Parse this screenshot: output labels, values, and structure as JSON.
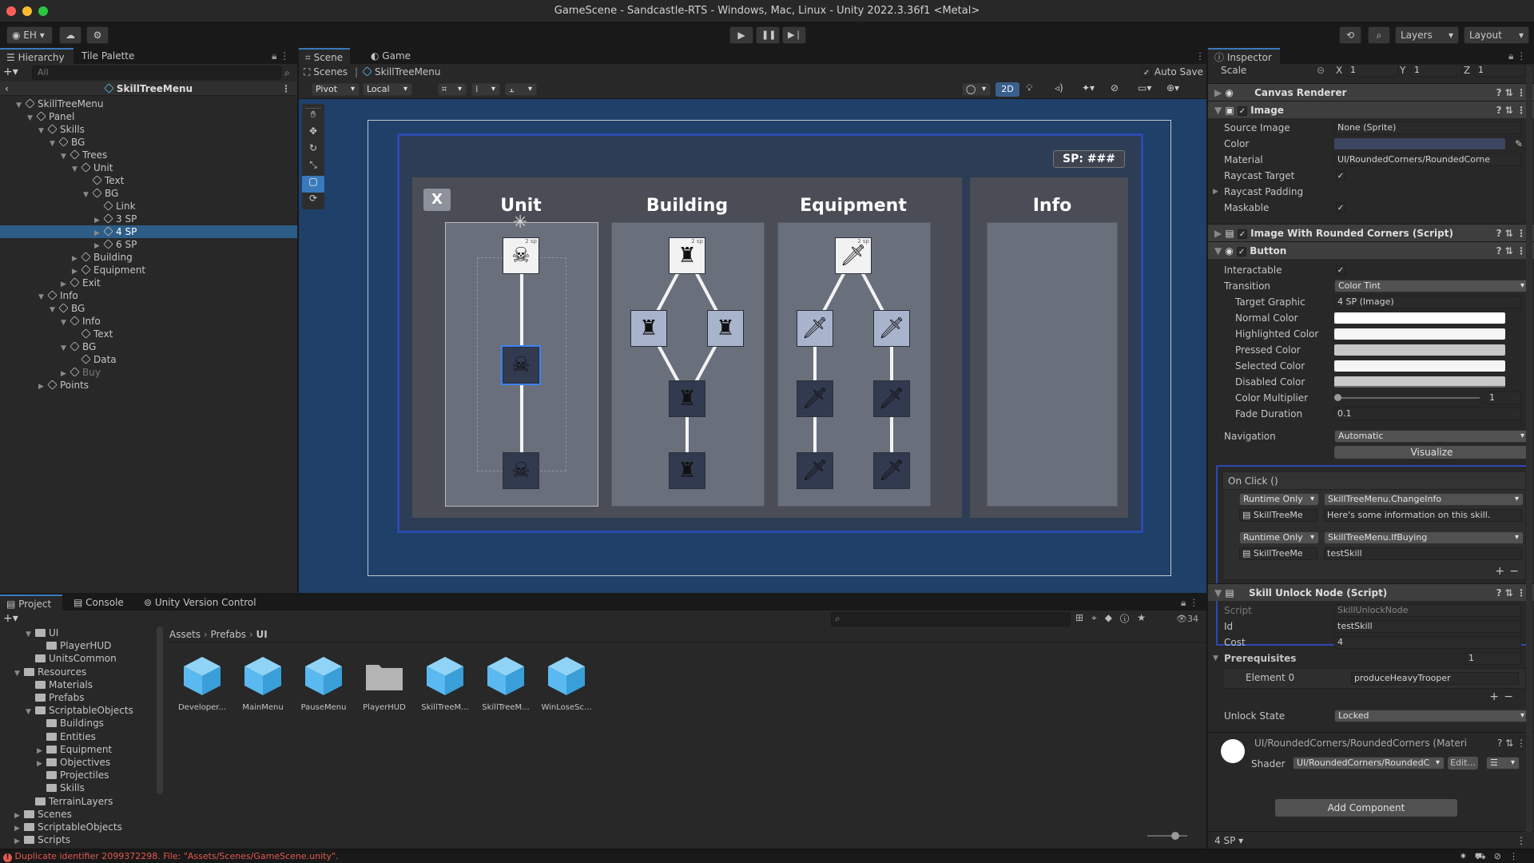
{
  "window": {
    "title": "GameScene - Sandcastle-RTS - Windows, Mac, Linux - Unity 2022.3.36f1 <Metal>"
  },
  "toolbar": {
    "account": "EH",
    "layers": "Layers",
    "layout": "Layout"
  },
  "hierarchy": {
    "tab": "Hierarchy",
    "tab2": "Tile Palette",
    "search_placeholder": "All",
    "root": "SkillTreeMenu",
    "rows": [
      {
        "label": "SkillTreeMenu",
        "indent": 0,
        "arrow": "▼"
      },
      {
        "label": "Panel",
        "indent": 1,
        "arrow": "▼"
      },
      {
        "label": "Skills",
        "indent": 2,
        "arrow": "▼"
      },
      {
        "label": "BG",
        "indent": 3,
        "arrow": "▼"
      },
      {
        "label": "Trees",
        "indent": 4,
        "arrow": "▼"
      },
      {
        "label": "Unit",
        "indent": 5,
        "arrow": "▼"
      },
      {
        "label": "Text",
        "indent": 6,
        "arrow": ""
      },
      {
        "label": "BG",
        "indent": 6,
        "arrow": "▼"
      },
      {
        "label": "Link",
        "indent": 7,
        "arrow": ""
      },
      {
        "label": "3 SP",
        "indent": 7,
        "arrow": "▶"
      },
      {
        "label": "4 SP",
        "indent": 7,
        "arrow": "▶",
        "selected": true
      },
      {
        "label": "6 SP",
        "indent": 7,
        "arrow": "▶"
      },
      {
        "label": "Building",
        "indent": 5,
        "arrow": "▶"
      },
      {
        "label": "Equipment",
        "indent": 5,
        "arrow": "▶"
      },
      {
        "label": "Exit",
        "indent": 4,
        "arrow": "▶"
      },
      {
        "label": "Info",
        "indent": 2,
        "arrow": "▼"
      },
      {
        "label": "BG",
        "indent": 3,
        "arrow": "▼"
      },
      {
        "label": "Info",
        "indent": 4,
        "arrow": "▼"
      },
      {
        "label": "Text",
        "indent": 5,
        "arrow": ""
      },
      {
        "label": "BG",
        "indent": 4,
        "arrow": "▼"
      },
      {
        "label": "Data",
        "indent": 5,
        "arrow": ""
      },
      {
        "label": "Buy",
        "indent": 4,
        "arrow": "▶",
        "dim": true
      },
      {
        "label": "Points",
        "indent": 2,
        "arrow": "▶"
      }
    ]
  },
  "scene": {
    "tab": "Scene",
    "tab2": "Game",
    "breadcrumb_root": "Scenes",
    "breadcrumb_item": "SkillTreeMenu",
    "auto_save": "Auto Save",
    "pivot": "Pivot",
    "local": "Local",
    "mode_2d": "2D",
    "game": {
      "sp": "SP: ###",
      "close": "X",
      "columns": [
        "Unit",
        "Building",
        "Equipment",
        "Info"
      ],
      "sp_label": "2 sp"
    }
  },
  "inspector": {
    "tab": "Inspector",
    "scale": {
      "label": "Scale",
      "x": "1",
      "y": "1",
      "z": "1"
    },
    "canvas_renderer": "Canvas Renderer",
    "image": {
      "title": "Image",
      "source_label": "Source Image",
      "source": "None (Sprite)",
      "color_label": "Color",
      "material_label": "Material",
      "material": "UI/RoundedCorners/RoundedCorne",
      "raycast_target": "Raycast Target",
      "raycast_padding": "Raycast Padding",
      "maskable": "Maskable"
    },
    "rounded": "Image With Rounded Corners (Script)",
    "button": {
      "title": "Button",
      "interactable": "Interactable",
      "transition_label": "Transition",
      "transition": "Color Tint",
      "target_label": "Target Graphic",
      "target": "4 SP (Image)",
      "normal": "Normal Color",
      "highlighted": "Highlighted Color",
      "pressed": "Pressed Color",
      "selected": "Selected Color",
      "disabled": "Disabled Color",
      "multiplier_label": "Color Multiplier",
      "multiplier": "1",
      "fade_label": "Fade Duration",
      "fade": "0.1",
      "nav_label": "Navigation",
      "nav": "Automatic",
      "visualize": "Visualize"
    },
    "onclick": {
      "title": "On Click ()",
      "runtime": "Runtime Only",
      "obj": "SkillTreeMe",
      "fn1": "SkillTreeMenu.ChangeInfo",
      "arg1": "Here's some information on this skill.",
      "fn2": "SkillTreeMenu.IfBuying",
      "arg2": "testSkill"
    },
    "skill_node": {
      "title": "Skill Unlock Node (Script)",
      "script_label": "Script",
      "script": "SkillUnlockNode",
      "id_label": "Id",
      "id": "testSkill",
      "cost_label": "Cost",
      "cost": "4",
      "prereq_label": "Prerequisites",
      "prereq_count": "1",
      "element_label": "Element 0",
      "element": "produceHeavyTrooper",
      "unlock_label": "Unlock State",
      "unlock": "Locked"
    },
    "material": {
      "name": "UI/RoundedCorners/RoundedCorners (Materi",
      "shader_label": "Shader",
      "shader": "UI/RoundedCorners/RoundedC",
      "edit": "Edit..."
    },
    "add_component": "Add Component",
    "footer": "4 SP"
  },
  "project": {
    "tab": "Project",
    "tab2": "Console",
    "tab3": "Unity Version Control",
    "count": "34",
    "breadcrumb": [
      "Assets",
      "Prefabs",
      "UI"
    ],
    "tree": [
      {
        "label": "UI",
        "indent": 2,
        "arrow": "▼"
      },
      {
        "label": "PlayerHUD",
        "indent": 3,
        "arrow": ""
      },
      {
        "label": "UnitsCommon",
        "indent": 2,
        "arrow": ""
      },
      {
        "label": "Resources",
        "indent": 1,
        "arrow": "▼"
      },
      {
        "label": "Materials",
        "indent": 2,
        "arrow": ""
      },
      {
        "label": "Prefabs",
        "indent": 2,
        "arrow": ""
      },
      {
        "label": "ScriptableObjects",
        "indent": 2,
        "arrow": "▼"
      },
      {
        "label": "Buildings",
        "indent": 3,
        "arrow": ""
      },
      {
        "label": "Entities",
        "indent": 3,
        "arrow": ""
      },
      {
        "label": "Equipment",
        "indent": 3,
        "arrow": "▶"
      },
      {
        "label": "Objectives",
        "indent": 3,
        "arrow": "▶"
      },
      {
        "label": "Projectiles",
        "indent": 3,
        "arrow": ""
      },
      {
        "label": "Skills",
        "indent": 3,
        "arrow": ""
      },
      {
        "label": "TerrainLayers",
        "indent": 2,
        "arrow": ""
      },
      {
        "label": "Scenes",
        "indent": 1,
        "arrow": "▶"
      },
      {
        "label": "ScriptableObjects",
        "indent": 1,
        "arrow": "▶"
      },
      {
        "label": "Scripts",
        "indent": 1,
        "arrow": "▶"
      }
    ],
    "assets": [
      {
        "label": "Developer...",
        "kind": "prefab"
      },
      {
        "label": "MainMenu",
        "kind": "prefab"
      },
      {
        "label": "PauseMenu",
        "kind": "prefab"
      },
      {
        "label": "PlayerHUD",
        "kind": "folder"
      },
      {
        "label": "SkillTreeM...",
        "kind": "prefab"
      },
      {
        "label": "SkillTreeM...",
        "kind": "prefab"
      },
      {
        "label": "WinLoseSc...",
        "kind": "prefab"
      }
    ]
  },
  "status": {
    "error": "Duplicate identifier 2099372298. File: \"Assets/Scenes/GameScene.unity\"."
  },
  "colors": {
    "accent": "#3a79bb",
    "selection": "#2c5d87",
    "error": "#e05a4f",
    "node_light": "#a8b4cc",
    "node_dark": "#323a4f"
  }
}
